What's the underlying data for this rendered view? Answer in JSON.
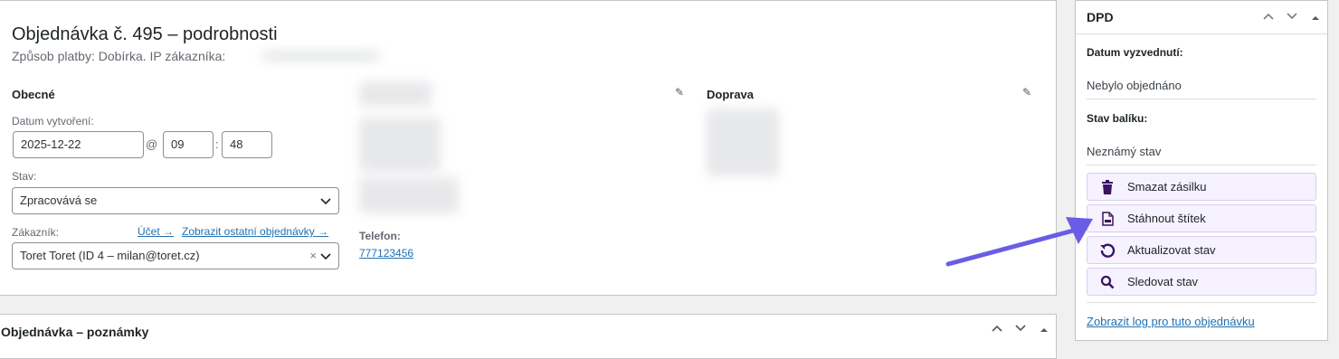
{
  "order": {
    "title": "Objednávka č. 495 – podrobnosti",
    "payment_line": "Způsob platby: Dobírka. IP zákazníka:"
  },
  "general": {
    "heading": "Obecné",
    "created_label": "Datum vytvoření:",
    "date_value": "2025-12-22",
    "at": "@",
    "hour": "09",
    "colon": ":",
    "minute": "48",
    "status_label": "Stav:",
    "status_value": "Zpracovává se",
    "customer_label": "Zákazník:",
    "account_link": "Účet →",
    "other_orders_link": "Zobrazit ostatní objednávky →",
    "customer_value": "Toret Toret (ID 4 – milan@toret.cz)",
    "clear_x": "×"
  },
  "billing": {
    "phone_label": "Telefon:",
    "phone_value": "777123456"
  },
  "shipping": {
    "heading": "Doprava"
  },
  "notes": {
    "heading": "Objednávka – poznámky"
  },
  "dpd": {
    "title": "DPD",
    "pickup_label": "Datum vyzvednutí:",
    "pickup_value": "Nebylo objednáno",
    "package_label": "Stav balíku:",
    "package_value": "Neznámý stav",
    "buttons": [
      {
        "label": "Smazat zásilku",
        "icon": "trash-icon"
      },
      {
        "label": "Stáhnout štítek",
        "icon": "pdf-file-icon"
      },
      {
        "label": "Aktualizovat stav",
        "icon": "refresh-icon"
      },
      {
        "label": "Sledovat stav",
        "icon": "search-icon"
      }
    ],
    "log_link": "Zobrazit log pro tuto objednávku"
  },
  "colors": {
    "link": "#2271b1",
    "button_bg": "#f6f2ff",
    "icon_purple": "#3c1361",
    "arrow": "#6b5ce7"
  }
}
